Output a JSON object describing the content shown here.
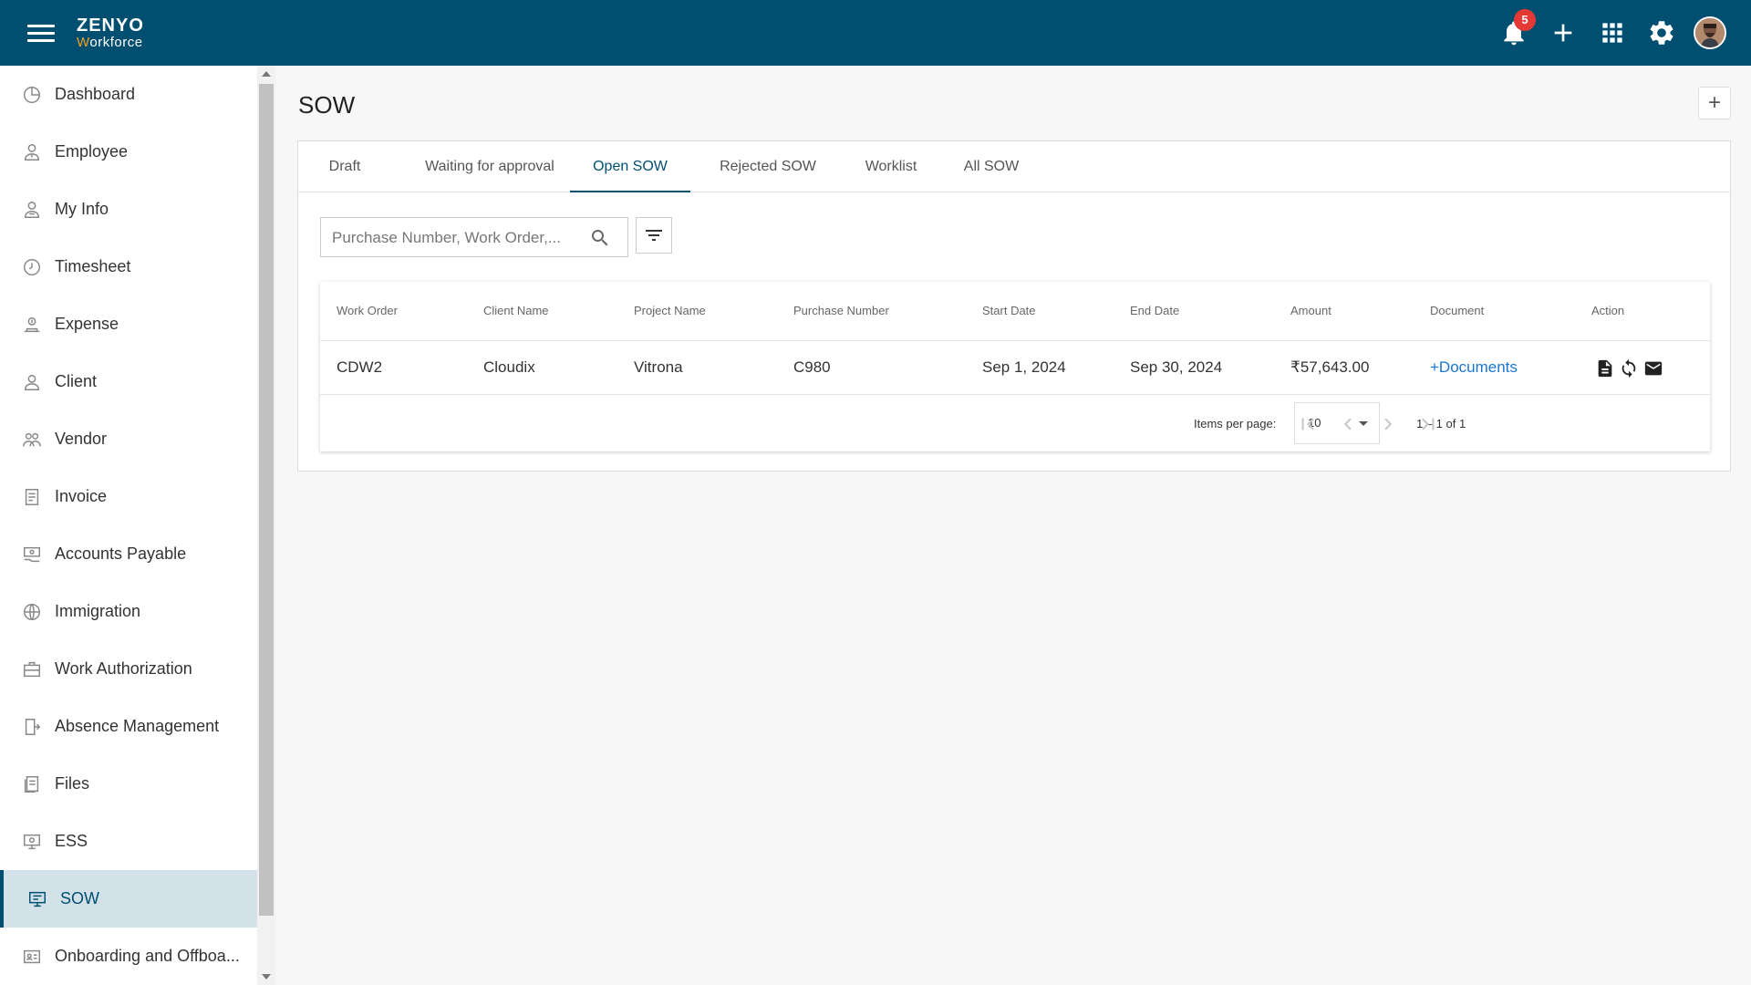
{
  "brand": {
    "name_top": "ZENYO",
    "name_bottom_initial": "W",
    "name_bottom_rest": "orkforce"
  },
  "topbar": {
    "notifications_count": "5",
    "icons": [
      "menu-icon",
      "bell-icon",
      "plus-icon",
      "apps-grid-icon",
      "gear-icon",
      "user-avatar"
    ]
  },
  "sidebar": {
    "items": [
      {
        "label": "Dashboard",
        "icon": "dashboard-icon"
      },
      {
        "label": "Employee",
        "icon": "employee-icon"
      },
      {
        "label": "My Info",
        "icon": "my-info-icon"
      },
      {
        "label": "Timesheet",
        "icon": "clock-icon"
      },
      {
        "label": "Expense",
        "icon": "expense-icon"
      },
      {
        "label": "Client",
        "icon": "client-icon"
      },
      {
        "label": "Vendor",
        "icon": "vendor-icon"
      },
      {
        "label": "Invoice",
        "icon": "invoice-icon"
      },
      {
        "label": "Accounts Payable",
        "icon": "accounts-payable-icon"
      },
      {
        "label": "Immigration",
        "icon": "globe-icon"
      },
      {
        "label": "Work Authorization",
        "icon": "briefcase-icon"
      },
      {
        "label": "Absence Management",
        "icon": "door-icon"
      },
      {
        "label": "Files",
        "icon": "files-icon"
      },
      {
        "label": "ESS",
        "icon": "ess-icon"
      },
      {
        "label": "SOW",
        "icon": "sow-icon",
        "active": true
      },
      {
        "label": "Onboarding and Offboa...",
        "icon": "id-card-icon"
      }
    ]
  },
  "main": {
    "title": "SOW",
    "tabs": [
      "Draft",
      "Waiting for approval",
      "Open SOW",
      "Rejected SOW",
      "Worklist",
      "All SOW"
    ],
    "active_tab": "Open SOW",
    "search": {
      "placeholder": "Purchase Number, Work Order,...",
      "value": ""
    },
    "table": {
      "columns": [
        "Work Order",
        "Client Name",
        "Project Name",
        "Purchase Number",
        "Start Date",
        "End Date",
        "Amount",
        "Document",
        "Action"
      ],
      "rows": [
        {
          "work_order": "CDW2",
          "client_name": "Cloudix",
          "project_name": "Vitrona",
          "purchase_number": "C980",
          "start_date": "Sep 1, 2024",
          "end_date": "Sep 30, 2024",
          "amount": "₹57,643.00",
          "document": "+Documents",
          "actions": [
            "document-icon",
            "refresh-icon",
            "mail-icon"
          ]
        }
      ]
    },
    "paginator": {
      "items_per_page_label": "Items per page:",
      "items_per_page": "10",
      "range": "1 – 1 of 1"
    }
  },
  "colors": {
    "header": "#004f70",
    "link": "#1976d2",
    "badge": "#e53935",
    "active_bg": "#d3e1e9"
  }
}
